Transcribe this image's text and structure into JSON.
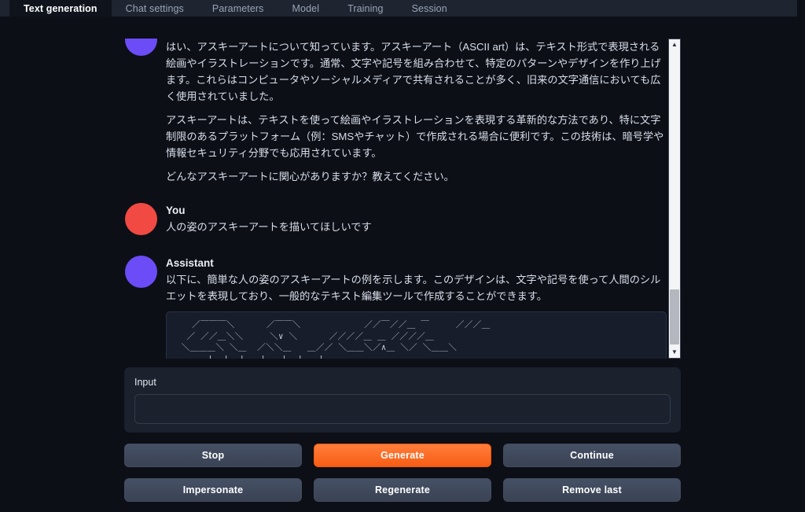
{
  "tabs": [
    {
      "label": "Text generation",
      "active": true
    },
    {
      "label": "Chat settings",
      "active": false
    },
    {
      "label": "Parameters",
      "active": false
    },
    {
      "label": "Model",
      "active": false
    },
    {
      "label": "Training",
      "active": false
    },
    {
      "label": "Session",
      "active": false
    }
  ],
  "chat": {
    "messages": [
      {
        "role": "Assistant",
        "name_visible": false,
        "avatar_color": "#6b4cf6",
        "paragraphs": [
          "はい、アスキーアートについて知っています。アスキーアート（ASCII art）は、テキスト形式で表現される絵画やイラストレーションです。通常、文字や記号を組み合わせて、特定のパターンやデザインを作り上げます。これらはコンピュータやソーシャルメディアで共有されることが多く、旧来の文字通信においても広く使用されていました。",
          "アスキーアートは、テキストを使って絵画やイラストレーションを表現する革新的な方法であり、特に文字制限のあるプラットフォーム（例：SMSやチャット）で作成される場合に便利です。この技術は、暗号学や情報セキュリティ分野でも応用されています。",
          "どんなアスキーアートに関心がありますか？教えてください。"
        ]
      },
      {
        "role": "You",
        "name_visible": true,
        "avatar_color": "#f04a42",
        "paragraphs": [
          "人の姿のアスキーアートを描いてほしいです"
        ]
      },
      {
        "role": "Assistant",
        "name_visible": true,
        "avatar_color": "#6b4cf6",
        "paragraphs": [
          "以下に、簡単な人の姿のアスキーアートの例を示します。このデザインは、文字や記号を使って人間のシルエットを表現しており、一般的なテキスト編集ツールで作成することができます。"
        ],
        "code": "   ／￣￣￣＼      ／￣￣＼            ／／￣／／＿ ￣     ／／／＿\n  ／ ／／＿＼＼     ＼∨ ＼      ／／／／＿ ＿ ／／／／＿\n ＼＿＿＿＼ ＼＿  ／＼＼＿   ＿／／ ＼＿＿＼／∧＿ ＼／ ＼＿＿＼\n      |  |  |   |   |  |   |"
      }
    ],
    "scrollbar": {
      "up_arrow": "scroll-up-arrow-icon",
      "down_arrow": "scroll-down-arrow-icon"
    }
  },
  "input": {
    "label": "Input",
    "value": "",
    "placeholder": ""
  },
  "buttons": [
    {
      "label": "Stop",
      "primary": false
    },
    {
      "label": "Generate",
      "primary": true
    },
    {
      "label": "Continue",
      "primary": false
    },
    {
      "label": "Impersonate",
      "primary": false
    },
    {
      "label": "Regenerate",
      "primary": false
    },
    {
      "label": "Remove last",
      "primary": false
    }
  ],
  "colors": {
    "page_bg": "#0c0f16",
    "tabbar_bg": "#1e2430",
    "accent_orange": "#f75d14",
    "assistant_avatar": "#6b4cf6",
    "user_avatar": "#f04a42",
    "panel_bg": "#1b212d",
    "code_bg": "#171d2b"
  }
}
